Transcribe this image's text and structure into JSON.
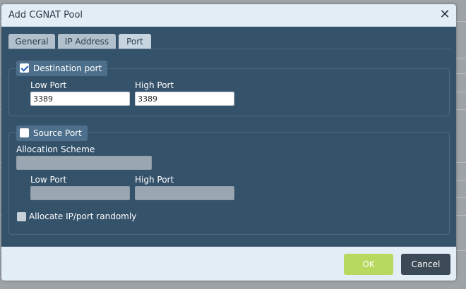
{
  "dialog": {
    "title": "Add CGNAT Pool",
    "close_symbol": "✕"
  },
  "tabs": [
    {
      "label": "General",
      "active": false
    },
    {
      "label": "IP Address",
      "active": false
    },
    {
      "label": "Port",
      "active": true
    }
  ],
  "destination": {
    "label": "Destination port",
    "checked": true,
    "low_port_label": "Low Port",
    "low_port_value": "3389",
    "high_port_label": "High Port",
    "high_port_value": "3389"
  },
  "source": {
    "label": "Source Port",
    "checked": false,
    "allocation_scheme_label": "Allocation Scheme",
    "allocation_scheme_value": "",
    "low_port_label": "Low Port",
    "low_port_value": "",
    "high_port_label": "High Port",
    "high_port_value": "",
    "random_label": "Allocate IP/port randomly",
    "random_checked": false
  },
  "footer": {
    "ok_label": "OK",
    "cancel_label": "Cancel"
  },
  "colors": {
    "dialog_body": "#35526b",
    "titlebar": "#e3edf6",
    "ok_button": "#b7d95e",
    "cancel_button": "#3b4a56"
  }
}
